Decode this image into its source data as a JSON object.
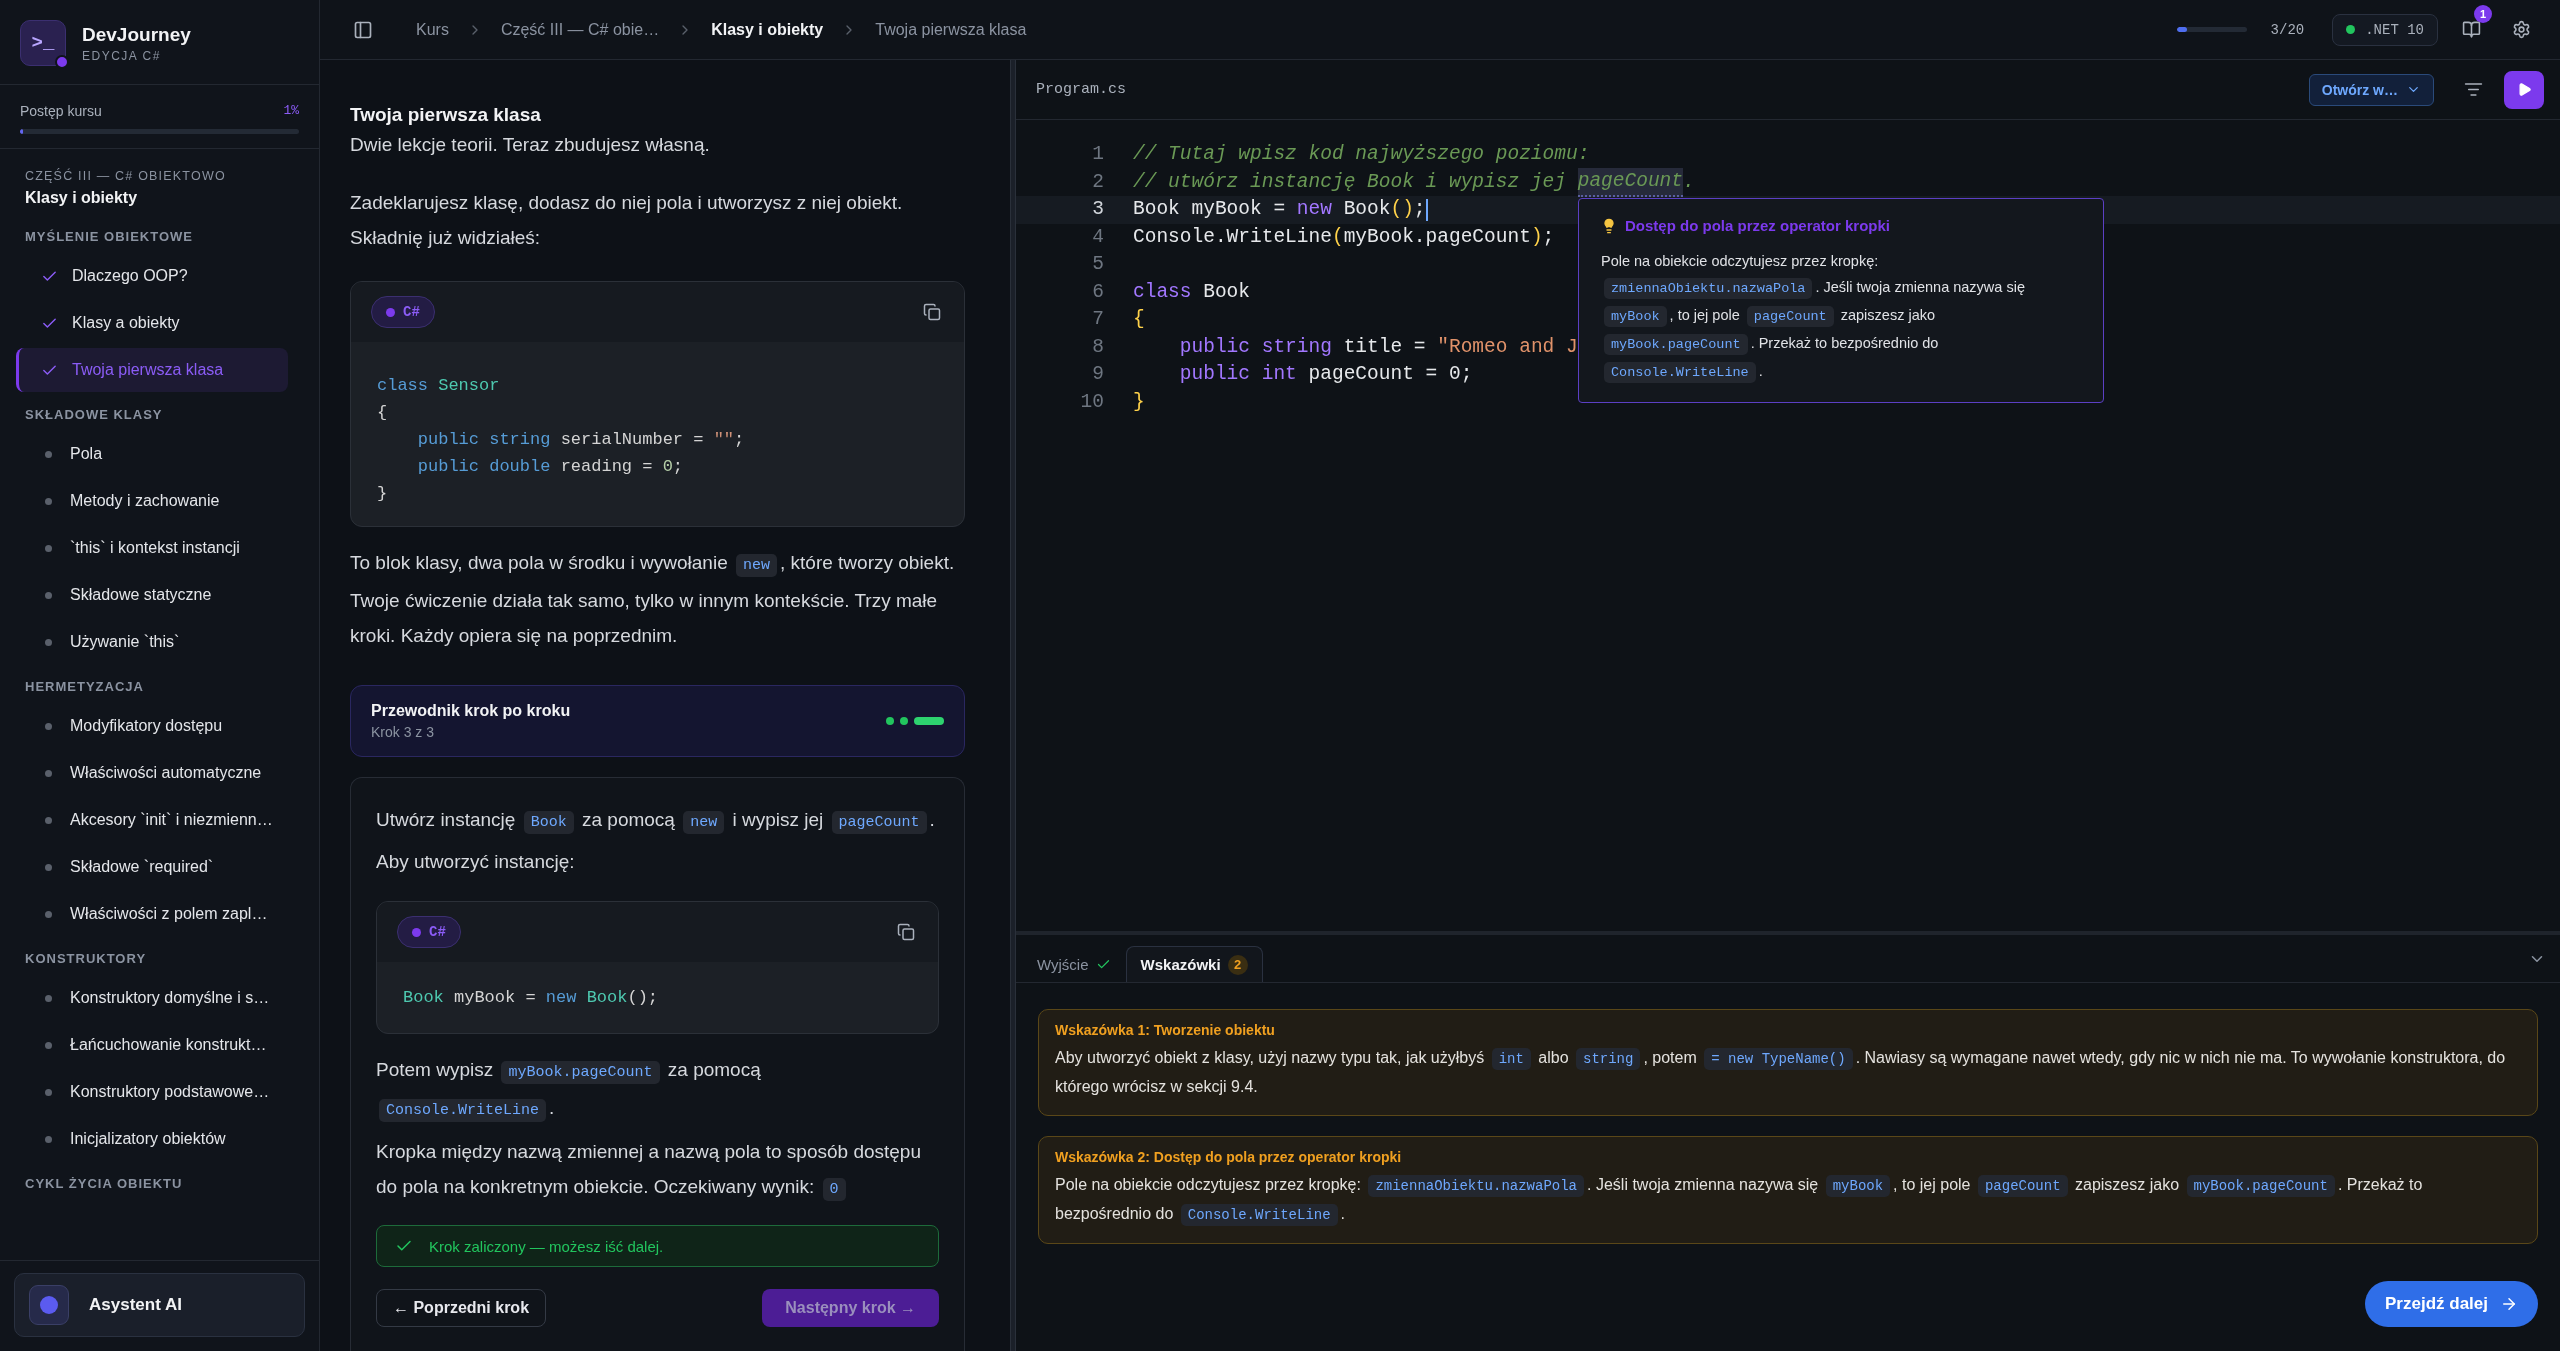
{
  "brand": {
    "logo_text": ">_",
    "name": "DevJourney",
    "edition": "EDYCJA C#"
  },
  "course_progress": {
    "label": "Postęp kursu",
    "value": "1%",
    "level": 0.01
  },
  "sidebar": {
    "part": "CZĘŚĆ III — C# OBIEKTOWO",
    "chapter": "Klasy i obiekty",
    "groups": [
      {
        "title": "MYŚLENIE OBIEKTOWE",
        "items": [
          {
            "label": "Dlaczego OOP?",
            "done": true,
            "selected": false
          },
          {
            "label": "Klasy a obiekty",
            "done": true,
            "selected": false
          },
          {
            "label": "Twoja pierwsza klasa",
            "done": true,
            "selected": true
          }
        ]
      },
      {
        "title": "SKŁADOWE KLASY",
        "items": [
          {
            "label": "Pola",
            "done": false,
            "selected": false
          },
          {
            "label": "Metody i zachowanie",
            "done": false,
            "selected": false
          },
          {
            "label": "`this` i kontekst instancji",
            "done": false,
            "selected": false
          },
          {
            "label": "Składowe statyczne",
            "done": false,
            "selected": false
          },
          {
            "label": "Używanie `this`",
            "done": false,
            "selected": false
          }
        ]
      },
      {
        "title": "HERMETYZACJA",
        "items": [
          {
            "label": "Modyfikatory dostępu",
            "done": false,
            "selected": false
          },
          {
            "label": "Właściwości automatyczne",
            "done": false,
            "selected": false
          },
          {
            "label": "Akcesory `init` i niezmienn…",
            "done": false,
            "selected": false
          },
          {
            "label": "Składowe `required`",
            "done": false,
            "selected": false
          },
          {
            "label": "Właściwości z polem zapl…",
            "done": false,
            "selected": false
          }
        ]
      },
      {
        "title": "KONSTRUKTORY",
        "items": [
          {
            "label": "Konstruktory domyślne i s…",
            "done": false,
            "selected": false
          },
          {
            "label": "Łańcuchowanie konstrukt…",
            "done": false,
            "selected": false
          },
          {
            "label": "Konstruktory podstawowe…",
            "done": false,
            "selected": false
          },
          {
            "label": "Inicjalizatory obiektów",
            "done": false,
            "selected": false
          }
        ]
      },
      {
        "title": "CYKL ŻYCIA OBIEKTU"
      }
    ]
  },
  "assistant": {
    "label": "Asystent AI"
  },
  "breadcrumbs": [
    {
      "label": "Kurs",
      "selected": false
    },
    {
      "label": "Część III — C# obie…",
      "selected": false
    },
    {
      "label": "Klasy i obiekty",
      "selected": true
    },
    {
      "label": "Twoja pierwsza klasa",
      "selected": false
    }
  ],
  "topbar": {
    "progress": {
      "level": 0.15,
      "reading": "3/20"
    },
    "runtime": ".NET 10",
    "notifications": "1"
  },
  "lesson": {
    "title": "Twoja pierwsza klasa",
    "subtitle": "Dwie lekcje teorii. Teraz zbudujesz własną.",
    "intro": [
      {
        "kind": "text",
        "text": "Zadeklarujesz klasę, dodasz do niej pola i utworzysz z niej obiekt. Składnię już widziałeś:"
      }
    ],
    "example": {
      "language": "C#",
      "lines": [
        {
          "indented": false,
          "tokens": [
            {
              "kind": "keyword",
              "text": "class"
            },
            {
              "kind": "type",
              "text": " Sensor"
            }
          ]
        },
        {
          "indented": false,
          "tokens": [
            {
              "kind": "plain",
              "text": "{"
            }
          ]
        },
        {
          "indented": true,
          "tokens": [
            {
              "kind": "keyword",
              "text": "public"
            },
            {
              "kind": "keyword",
              "text": " string"
            },
            {
              "kind": "plain",
              "text": " serialNumber = "
            },
            {
              "kind": "string",
              "text": "\"\""
            },
            {
              "kind": "plain",
              "text": ";"
            }
          ]
        },
        {
          "indented": true,
          "tokens": [
            {
              "kind": "keyword",
              "text": "public"
            },
            {
              "kind": "keyword",
              "text": " double"
            },
            {
              "kind": "plain",
              "text": " reading = "
            },
            {
              "kind": "number",
              "text": "0"
            },
            {
              "kind": "plain",
              "text": ";"
            }
          ]
        },
        {
          "indented": false,
          "tokens": [
            {
              "kind": "plain",
              "text": "}"
            }
          ]
        }
      ]
    },
    "explanation": [
      {
        "kind": "text",
        "text": "To blok klasy, dwa pola w środku i wywołanie "
      },
      {
        "kind": "code",
        "text": "new"
      },
      {
        "kind": "text",
        "text": ", które tworzy obiekt. Twoje ćwiczenie działa tak samo, tylko w innym kontekście. Trzy małe kroki. Każdy opiera się na poprzednim."
      }
    ],
    "guide": {
      "title": "Przewodnik krok po kroku",
      "step": "Krok 3 z 3",
      "steps": [
        {
          "done": true,
          "current": false
        },
        {
          "done": true,
          "current": false
        },
        {
          "done": true,
          "current": true
        }
      ]
    },
    "task": {
      "instruction": [
        {
          "kind": "text",
          "text": "Utwórz instancję "
        },
        {
          "kind": "code",
          "text": "Book"
        },
        {
          "kind": "text",
          "text": " za pomocą "
        },
        {
          "kind": "code",
          "text": "new"
        },
        {
          "kind": "text",
          "text": " i wypisz jej "
        },
        {
          "kind": "code",
          "text": "pageCount"
        },
        {
          "kind": "text",
          "text": "."
        }
      ],
      "lead": [
        {
          "kind": "text",
          "text": "Aby utworzyć instancję:"
        }
      ],
      "snippet": {
        "language": "C#",
        "lines": [
          {
            "indented": false,
            "tokens": [
              {
                "kind": "type",
                "text": "Book"
              },
              {
                "kind": "plain",
                "text": " myBook = "
              },
              {
                "kind": "keyword",
                "text": "new"
              },
              {
                "kind": "type",
                "text": " Book"
              },
              {
                "kind": "plain",
                "text": "();"
              }
            ]
          }
        ]
      },
      "then": [
        {
          "kind": "text",
          "text": "Potem wypisz "
        },
        {
          "kind": "code",
          "text": "myBook.pageCount"
        },
        {
          "kind": "text",
          "text": " za pomocą "
        },
        {
          "kind": "code",
          "text": "Console.WriteLine"
        },
        {
          "kind": "text",
          "text": "."
        }
      ],
      "note": [
        {
          "kind": "text",
          "text": "Kropka między nazwą zmiennej a nazwą pola to sposób dostępu do pola na konkretnym obiekcie. Oczekiwany wynik: "
        },
        {
          "kind": "code",
          "text": "0"
        }
      ],
      "success": "Krok zaliczony — możesz iść dalej.",
      "prev": {
        "label": "← Poprzedni krok",
        "disabled": false
      },
      "next": {
        "label": "Następny krok →",
        "disabled": true
      }
    }
  },
  "editor": {
    "file": "Program.cs",
    "open_in": "Otwórz w…",
    "lines": [
      {
        "number": "1",
        "active": false,
        "indented": false,
        "tokens": [
          {
            "kind": "comment",
            "text": "// Tutaj wpisz kod najwyższego poziomu:"
          }
        ]
      },
      {
        "number": "2",
        "active": false,
        "indented": false,
        "tokens": [
          {
            "kind": "comment",
            "text": "// utwórz instancję Book i wypisz jej "
          },
          {
            "kind": "comment-mark",
            "text": "pageCount"
          },
          {
            "kind": "comment",
            "text": "."
          }
        ]
      },
      {
        "number": "3",
        "active": true,
        "indented": false,
        "tokens": [
          {
            "kind": "plain",
            "text": "Book myBook = "
          },
          {
            "kind": "keyword",
            "text": "new"
          },
          {
            "kind": "plain",
            "text": " Book"
          },
          {
            "kind": "bracket",
            "text": "()"
          },
          {
            "kind": "plain",
            "text": ";"
          }
        ]
      },
      {
        "number": "4",
        "active": false,
        "indented": false,
        "tokens": [
          {
            "kind": "plain",
            "text": "Console.WriteLine"
          },
          {
            "kind": "bracket",
            "text": "("
          },
          {
            "kind": "plain",
            "text": "myBook.pageCount"
          },
          {
            "kind": "bracket",
            "text": ")"
          },
          {
            "kind": "plain",
            "text": ";"
          }
        ]
      },
      {
        "number": "5",
        "active": false
      },
      {
        "number": "6",
        "active": false,
        "indented": false,
        "tokens": [
          {
            "kind": "keyword",
            "text": "class"
          },
          {
            "kind": "plain",
            "text": " Book"
          }
        ]
      },
      {
        "number": "7",
        "active": false,
        "indented": false,
        "tokens": [
          {
            "kind": "bracket",
            "text": "{"
          }
        ]
      },
      {
        "number": "8",
        "active": false,
        "indented": true,
        "tokens": [
          {
            "kind": "keyword",
            "text": "public"
          },
          {
            "kind": "keyword",
            "text": " string"
          },
          {
            "kind": "plain",
            "text": " title = "
          },
          {
            "kind": "string",
            "text": "\"Romeo and J"
          }
        ]
      },
      {
        "number": "9",
        "active": false,
        "indented": true,
        "tokens": [
          {
            "kind": "keyword",
            "text": "public"
          },
          {
            "kind": "keyword",
            "text": " int"
          },
          {
            "kind": "plain",
            "text": " pageCount = "
          },
          {
            "kind": "number",
            "text": "0"
          },
          {
            "kind": "plain",
            "text": ";"
          }
        ]
      },
      {
        "number": "10",
        "active": false,
        "indented": false,
        "tokens": [
          {
            "kind": "bracket",
            "text": "}"
          }
        ]
      }
    ],
    "tooltip": {
      "title": "Dostęp do pola przez operator kropki",
      "body": [
        {
          "kind": "text",
          "text": "Pole na obiekcie odczytujesz przez kropkę: "
        },
        {
          "kind": "code",
          "text": "zmiennaObiektu.nazwaPola"
        },
        {
          "kind": "text",
          "text": ". Jeśli twoja zmienna nazywa się "
        },
        {
          "kind": "code",
          "text": "myBook"
        },
        {
          "kind": "text",
          "text": ", to jej pole "
        },
        {
          "kind": "code",
          "text": "pageCount"
        },
        {
          "kind": "text",
          "text": " zapiszesz jako "
        },
        {
          "kind": "code",
          "text": "myBook.pageCount"
        },
        {
          "kind": "text",
          "text": ". Przekaż to bezpośrednio do "
        },
        {
          "kind": "code",
          "text": "Console.WriteLine"
        },
        {
          "kind": "text",
          "text": "."
        }
      ]
    }
  },
  "bottom_panel": {
    "tabs": [
      {
        "label": "Wyjście",
        "passed": true,
        "selected": false
      },
      {
        "label": "Wskazówki",
        "badge": "2",
        "selected": true
      }
    ],
    "hints": [
      {
        "title": "Wskazówka 1: Tworzenie obiektu",
        "body": [
          {
            "kind": "text",
            "text": "Aby utworzyć obiekt z klasy, użyj nazwy typu tak, jak użyłbyś "
          },
          {
            "kind": "code",
            "text": "int"
          },
          {
            "kind": "text",
            "text": " albo "
          },
          {
            "kind": "code",
            "text": "string"
          },
          {
            "kind": "text",
            "text": ", potem "
          },
          {
            "kind": "code",
            "text": "= new TypeName()"
          },
          {
            "kind": "text",
            "text": ". Nawiasy są wymagane nawet wtedy, gdy nic w nich nie ma. To wywołanie konstruktora, do którego wrócisz w sekcji 9.4."
          }
        ]
      },
      {
        "title": "Wskazówka 2: Dostęp do pola przez operator kropki",
        "body": [
          {
            "kind": "text",
            "text": "Pole na obiekcie odczytujesz przez kropkę: "
          },
          {
            "kind": "code",
            "text": "zmiennaObiektu.nazwaPola"
          },
          {
            "kind": "text",
            "text": ". Jeśli twoja zmienna nazywa się "
          },
          {
            "kind": "code",
            "text": "myBook"
          },
          {
            "kind": "text",
            "text": ", to jej pole "
          },
          {
            "kind": "code",
            "text": "pageCount"
          },
          {
            "kind": "text",
            "text": " zapiszesz jako "
          },
          {
            "kind": "code",
            "text": "myBook.pageCount"
          },
          {
            "kind": "text",
            "text": ". Przekaż to bezpośrednio do "
          },
          {
            "kind": "code",
            "text": "Console.WriteLine"
          },
          {
            "kind": "text",
            "text": "."
          }
        ]
      }
    ],
    "continue": "Przejdź dalej"
  }
}
